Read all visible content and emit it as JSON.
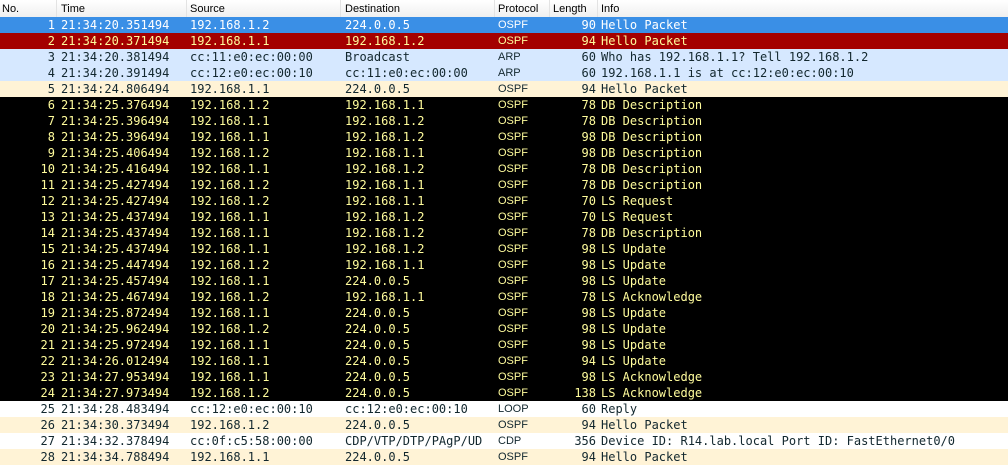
{
  "columns": {
    "no": "No.",
    "time": "Time",
    "source": "Source",
    "destination": "Destination",
    "protocol": "Protocol",
    "length": "Length",
    "info": "Info"
  },
  "colors": {
    "selected": "#3a8fe6",
    "red": "#a40000",
    "arp": "#d6e8ff",
    "ospf": "#fff3d6",
    "black": "#000000",
    "yellow_text": "#fffc9c"
  },
  "rows": [
    {
      "no": "1",
      "time": "21:34:20.351494",
      "source": "192.168.1.2",
      "destination": "224.0.0.5",
      "protocol": "OSPF",
      "length": "90",
      "info": "Hello Packet",
      "style": "sel"
    },
    {
      "no": "2",
      "time": "21:34:20.371494",
      "source": "192.168.1.1",
      "destination": "192.168.1.2",
      "protocol": "OSPF",
      "length": "94",
      "info": "Hello Packet",
      "style": "red"
    },
    {
      "no": "3",
      "time": "21:34:20.381494",
      "source": "cc:11:e0:ec:00:00",
      "destination": "Broadcast",
      "protocol": "ARP",
      "length": "60",
      "info": "Who has 192.168.1.1?  Tell 192.168.1.2",
      "style": "arp"
    },
    {
      "no": "4",
      "time": "21:34:20.391494",
      "source": "cc:12:e0:ec:00:10",
      "destination": "cc:11:e0:ec:00:00",
      "protocol": "ARP",
      "length": "60",
      "info": "192.168.1.1 is at cc:12:e0:ec:00:10",
      "style": "arp"
    },
    {
      "no": "5",
      "time": "21:34:24.806494",
      "source": "192.168.1.1",
      "destination": "224.0.0.5",
      "protocol": "OSPF",
      "length": "94",
      "info": "Hello Packet",
      "style": "ospf"
    },
    {
      "no": "6",
      "time": "21:34:25.376494",
      "source": "192.168.1.2",
      "destination": "192.168.1.1",
      "protocol": "OSPF",
      "length": "78",
      "info": "DB Description",
      "style": "err"
    },
    {
      "no": "7",
      "time": "21:34:25.396494",
      "source": "192.168.1.1",
      "destination": "192.168.1.2",
      "protocol": "OSPF",
      "length": "78",
      "info": "DB Description",
      "style": "err"
    },
    {
      "no": "8",
      "time": "21:34:25.396494",
      "source": "192.168.1.1",
      "destination": "192.168.1.2",
      "protocol": "OSPF",
      "length": "98",
      "info": "DB Description",
      "style": "err"
    },
    {
      "no": "9",
      "time": "21:34:25.406494",
      "source": "192.168.1.2",
      "destination": "192.168.1.1",
      "protocol": "OSPF",
      "length": "98",
      "info": "DB Description",
      "style": "err"
    },
    {
      "no": "10",
      "time": "21:34:25.416494",
      "source": "192.168.1.1",
      "destination": "192.168.1.2",
      "protocol": "OSPF",
      "length": "78",
      "info": "DB Description",
      "style": "err"
    },
    {
      "no": "11",
      "time": "21:34:25.427494",
      "source": "192.168.1.2",
      "destination": "192.168.1.1",
      "protocol": "OSPF",
      "length": "78",
      "info": "DB Description",
      "style": "err"
    },
    {
      "no": "12",
      "time": "21:34:25.427494",
      "source": "192.168.1.2",
      "destination": "192.168.1.1",
      "protocol": "OSPF",
      "length": "70",
      "info": "LS Request",
      "style": "err"
    },
    {
      "no": "13",
      "time": "21:34:25.437494",
      "source": "192.168.1.1",
      "destination": "192.168.1.2",
      "protocol": "OSPF",
      "length": "70",
      "info": "LS Request",
      "style": "err"
    },
    {
      "no": "14",
      "time": "21:34:25.437494",
      "source": "192.168.1.1",
      "destination": "192.168.1.2",
      "protocol": "OSPF",
      "length": "78",
      "info": "DB Description",
      "style": "err"
    },
    {
      "no": "15",
      "time": "21:34:25.437494",
      "source": "192.168.1.1",
      "destination": "192.168.1.2",
      "protocol": "OSPF",
      "length": "98",
      "info": "LS Update",
      "style": "err"
    },
    {
      "no": "16",
      "time": "21:34:25.447494",
      "source": "192.168.1.2",
      "destination": "192.168.1.1",
      "protocol": "OSPF",
      "length": "98",
      "info": "LS Update",
      "style": "err"
    },
    {
      "no": "17",
      "time": "21:34:25.457494",
      "source": "192.168.1.1",
      "destination": "224.0.0.5",
      "protocol": "OSPF",
      "length": "98",
      "info": "LS Update",
      "style": "err"
    },
    {
      "no": "18",
      "time": "21:34:25.467494",
      "source": "192.168.1.2",
      "destination": "192.168.1.1",
      "protocol": "OSPF",
      "length": "78",
      "info": "LS Acknowledge",
      "style": "err"
    },
    {
      "no": "19",
      "time": "21:34:25.872494",
      "source": "192.168.1.1",
      "destination": "224.0.0.5",
      "protocol": "OSPF",
      "length": "98",
      "info": "LS Update",
      "style": "err"
    },
    {
      "no": "20",
      "time": "21:34:25.962494",
      "source": "192.168.1.2",
      "destination": "224.0.0.5",
      "protocol": "OSPF",
      "length": "98",
      "info": "LS Update",
      "style": "err"
    },
    {
      "no": "21",
      "time": "21:34:25.972494",
      "source": "192.168.1.1",
      "destination": "224.0.0.5",
      "protocol": "OSPF",
      "length": "98",
      "info": "LS Update",
      "style": "err"
    },
    {
      "no": "22",
      "time": "21:34:26.012494",
      "source": "192.168.1.1",
      "destination": "224.0.0.5",
      "protocol": "OSPF",
      "length": "94",
      "info": "LS Update",
      "style": "err"
    },
    {
      "no": "23",
      "time": "21:34:27.953494",
      "source": "192.168.1.1",
      "destination": "224.0.0.5",
      "protocol": "OSPF",
      "length": "98",
      "info": "LS Acknowledge",
      "style": "err"
    },
    {
      "no": "24",
      "time": "21:34:27.973494",
      "source": "192.168.1.2",
      "destination": "224.0.0.5",
      "protocol": "OSPF",
      "length": "138",
      "info": "LS Acknowledge",
      "style": "err"
    },
    {
      "no": "25",
      "time": "21:34:28.483494",
      "source": "cc:12:e0:ec:00:10",
      "destination": "cc:12:e0:ec:00:10",
      "protocol": "LOOP",
      "length": "60",
      "info": "Reply",
      "style": "white"
    },
    {
      "no": "26",
      "time": "21:34:30.373494",
      "source": "192.168.1.2",
      "destination": "224.0.0.5",
      "protocol": "OSPF",
      "length": "94",
      "info": "Hello Packet",
      "style": "ospf"
    },
    {
      "no": "27",
      "time": "21:34:32.378494",
      "source": "cc:0f:c5:58:00:00",
      "destination": "CDP/VTP/DTP/PAgP/UD",
      "protocol": "CDP",
      "length": "356",
      "info": "Device ID: R14.lab.local  Port ID: FastEthernet0/0",
      "style": "white"
    },
    {
      "no": "28",
      "time": "21:34:34.788494",
      "source": "192.168.1.1",
      "destination": "224.0.0.5",
      "protocol": "OSPF",
      "length": "94",
      "info": "Hello Packet",
      "style": "ospf"
    }
  ]
}
